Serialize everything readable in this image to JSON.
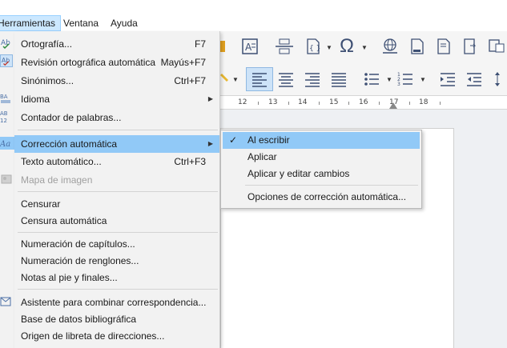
{
  "menubar": {
    "items": [
      {
        "label": "Herramientas"
      },
      {
        "label": "Ventana"
      },
      {
        "label": "Ayuda"
      }
    ]
  },
  "toolbar": {
    "icons": {
      "insert_text_box": "text-box-icon",
      "insert_field": "field-icon",
      "special_character": "omega-icon",
      "hyperlink": "globe-icon",
      "footnote": "footnote-icon",
      "align_left": "align-left-icon",
      "align_center": "align-center-icon",
      "align_right": "align-right-icon",
      "justify": "justify-icon",
      "bullets": "bullet-list-icon",
      "numbering": "numbered-list-icon"
    }
  },
  "ruler": {
    "labels": [
      "12",
      "13",
      "14",
      "15",
      "16",
      "17",
      "18"
    ]
  },
  "tools_menu": {
    "items": [
      {
        "label": "Ortografía...",
        "shortcut": "F7",
        "icon": "spellcheck-icon"
      },
      {
        "label": "Revisión ortográfica automática",
        "shortcut": "Mayús+F7",
        "icon": "auto-spellcheck-icon"
      },
      {
        "label": "Sinónimos...",
        "shortcut": "Ctrl+F7"
      },
      {
        "label": "Idioma",
        "submenu": true,
        "icon": "language-icon"
      },
      {
        "label": "Contador de palabras...",
        "icon": "word-count-icon"
      },
      {
        "label": "Corrección automática",
        "submenu": true,
        "highlighted": true,
        "icon": "autocorrect-icon"
      },
      {
        "label": "Texto automático...",
        "shortcut": "Ctrl+F3"
      },
      {
        "label": "Mapa de imagen",
        "disabled": true,
        "icon": "image-map-icon"
      },
      {
        "label": "Censurar"
      },
      {
        "label": "Censura automática"
      },
      {
        "label": "Numeración de capítulos..."
      },
      {
        "label": "Numeración de renglones..."
      },
      {
        "label": "Notas al pie y finales..."
      },
      {
        "label": "Asistente para combinar correspondencia...",
        "icon": "mail-merge-icon"
      },
      {
        "label": "Base de datos bibliográfica"
      },
      {
        "label": "Origen de libreta de direcciones..."
      }
    ]
  },
  "autocorrect_submenu": {
    "items": [
      {
        "label": "Al escribir",
        "checked": true,
        "highlighted": true
      },
      {
        "label": "Aplicar"
      },
      {
        "label": "Aplicar y editar cambios"
      },
      {
        "label": "Opciones de corrección automática..."
      }
    ]
  },
  "icon_glyphs": {
    "check": "✓",
    "submenu_arrow": "▶",
    "dropdown_arrow": "▼",
    "omega": "Ω"
  }
}
